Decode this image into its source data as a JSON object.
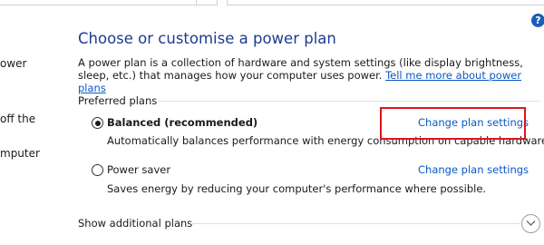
{
  "help_icon_glyph": "?",
  "left_pane": {
    "fragments": [
      "ower",
      "off the",
      "mputer"
    ]
  },
  "main": {
    "title": "Choose or customise a power plan",
    "description": "A power plan is a collection of hardware and system settings (like display brightness, sleep, etc.) that manages how your computer uses power.",
    "learn_more_link": "Tell me more about power plans"
  },
  "preferred_plans": {
    "header": "Preferred plans",
    "plans": [
      {
        "name": "Balanced (recommended)",
        "selected": true,
        "description": "Automatically balances performance with energy consumption on capable hardware.",
        "change_link": "Change plan settings"
      },
      {
        "name": "Power saver",
        "selected": false,
        "description": "Saves energy by reducing your computer's performance where possible.",
        "change_link": "Change plan settings"
      }
    ]
  },
  "additional_plans": {
    "header": "Show additional plans"
  },
  "colors": {
    "title": "#1e3b93",
    "link": "#0b58c5",
    "highlight": "#e0151b"
  }
}
